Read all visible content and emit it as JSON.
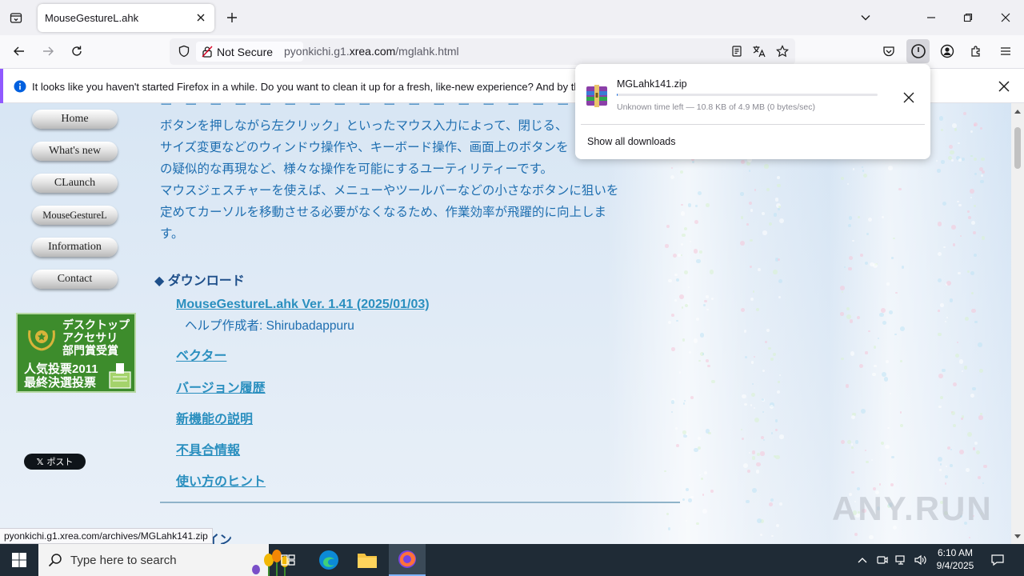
{
  "browser": {
    "tab_title": "MouseGestureL.ahk",
    "identity_label": "Not Secure",
    "url_prefix": "pyonkichi.g1.",
    "url_domain": "xrea.com",
    "url_path": "/mglahk.html"
  },
  "notification": {
    "text": "It looks like you haven't started Firefox in a while. Do you want to clean it up for a fresh, like-new experience? And by the way, welcome back!"
  },
  "downloads": {
    "file_name": "MGLahk141.zip",
    "progress": 0.002,
    "status": "Unknown time left — 10.8 KB of 4.9 MB (0 bytes/sec)",
    "show_all": "Show all downloads"
  },
  "sidebar": {
    "menu": [
      "Home",
      "What's new",
      "CLaunch",
      "MouseGestureL",
      "Information",
      "Contact"
    ],
    "award_line1": "デスクトップ",
    "award_line2": "アクセサリ",
    "award_line3": "部門賞受賞",
    "award_line4": "人気投票2011",
    "award_line5": "最終決選投票",
    "post_label": "ポスト"
  },
  "content": {
    "intro_lines": [
      "ボタンを押しながら左クリック」といったマウス入力によって、閉じる、",
      "サイズ変更などのウィンドウ操作や、キーボード操作、画面上のボタンを",
      "の疑似的な再現など、様々な操作を可能にするユーティリティーです。",
      "マウスジェスチャーを使えば、メニューやツールバーなどの小さなボタンに狙いを",
      "定めてカーソルを移動させる必要がなくなるため、作業効率が飛躍的に向上しま",
      "す。"
    ],
    "section_title": "◆ ダウンロード",
    "download_link": "MouseGestureL.ahk Ver. 1.41 (2025/01/03)",
    "helper": "ヘルプ作成者: Shirubadappuru",
    "links": [
      "ベクター",
      "バージョン履歴",
      "新機能の説明",
      "不具合情報",
      "使い方のヒント"
    ],
    "bottom_heading": "イン"
  },
  "status_url": "pyonkichi.g1.xrea.com/archives/MGLahk141.zip",
  "watermark": "ANY.RUN",
  "taskbar": {
    "search_placeholder": "Type here to search",
    "time": "6:10 AM",
    "date": "9/4/2025"
  }
}
